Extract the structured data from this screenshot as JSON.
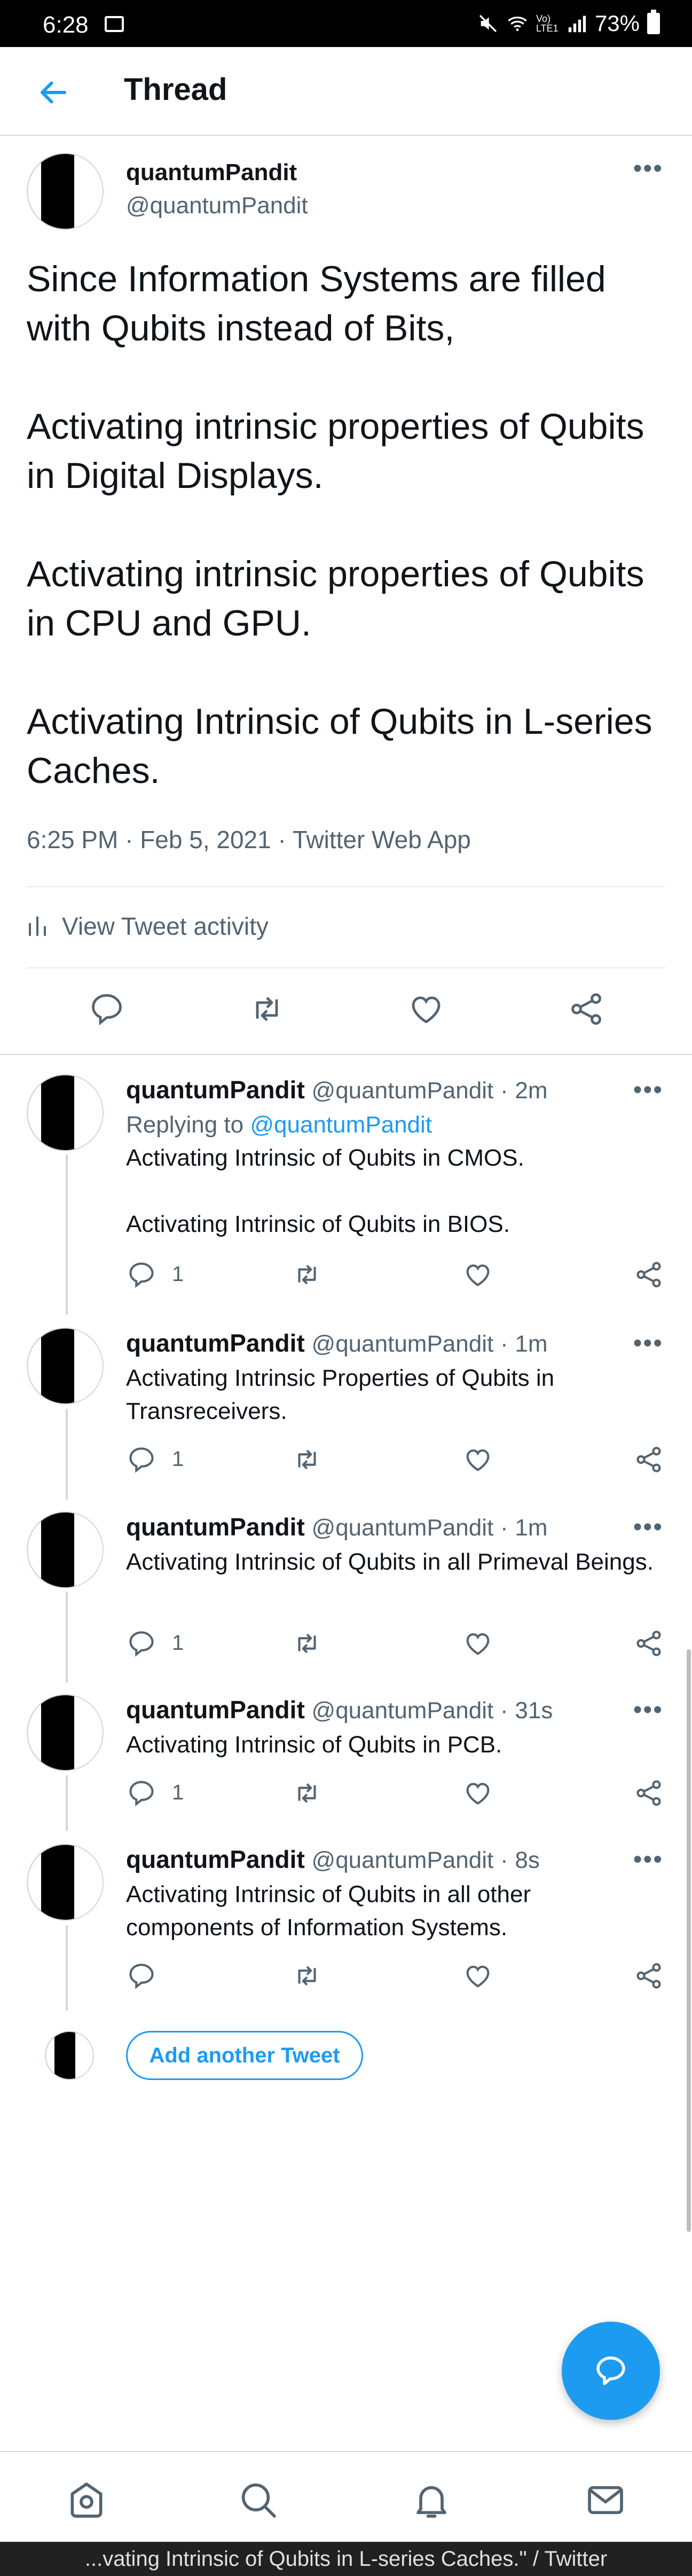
{
  "status_bar": {
    "time": "6:28",
    "network": "Vo) LTE1",
    "battery": "73%"
  },
  "header": {
    "title": "Thread"
  },
  "main_tweet": {
    "name": "quantumPandit",
    "handle": "@quantumPandit",
    "text": "Since Information Systems are filled with Qubits instead of Bits,\n\nActivating intrinsic properties of Qubits in Digital Displays.\n\nActivating intrinsic properties of Qubits in CPU and GPU.\n\nActivating Intrinsic of Qubits in L-series Caches.",
    "time": "6:25 PM",
    "date": "Feb 5, 2021",
    "client": "Twitter Web App",
    "separator": "·",
    "activity_label": "View Tweet activity"
  },
  "replies": [
    {
      "name": "quantumPandit",
      "handle": "@quantumPandit",
      "age": "2m",
      "replying_prefix": "Replying to ",
      "replying_to": "@quantumPandit",
      "text": "Activating Intrinsic of Qubits in CMOS.\n\nActivating Intrinsic of Qubits in BIOS.",
      "reply_count": "1"
    },
    {
      "name": "quantumPandit",
      "handle": "@quantumPandit",
      "age": "1m",
      "text": "Activating Intrinsic Properties of Qubits in Transreceivers.",
      "reply_count": "1"
    },
    {
      "name": "quantumPandit",
      "handle": "@quantumPandit",
      "age": "1m",
      "text": "Activating Intrinsic of Qubits in all Primeval Beings.",
      "reply_count": "1"
    },
    {
      "name": "quantumPandit",
      "handle": "@quantumPandit",
      "age": "31s",
      "text": "Activating Intrinsic of Qubits in PCB.",
      "reply_count": "1"
    },
    {
      "name": "quantumPandit",
      "handle": "@quantumPandit",
      "age": "8s",
      "text": "Activating Intrinsic of Qubits in all other components of Information Systems.",
      "reply_count": ""
    }
  ],
  "add_tweet_label": "Add another Tweet",
  "bottom_bar_text": "...vating Intrinsic of Qubits in L-series Caches.\" / Twitter",
  "colors": {
    "accent": "#1d9bf0",
    "secondary_text": "#536471",
    "border": "#cfd9de"
  },
  "icons": [
    "back-arrow-icon",
    "more-icon",
    "reply-icon",
    "retweet-icon",
    "like-icon",
    "share-icon",
    "activity-icon",
    "compose-icon",
    "home-icon",
    "search-icon",
    "notifications-icon",
    "messages-icon"
  ]
}
